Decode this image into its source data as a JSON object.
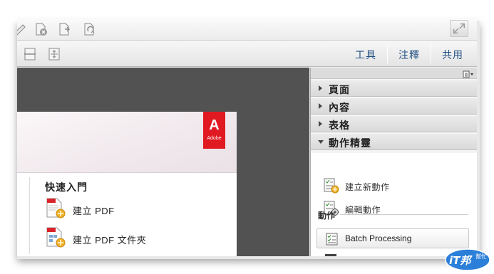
{
  "toolbar_tabs": {
    "tools": "工具",
    "comment": "注釋",
    "share": "共用"
  },
  "document": {
    "brand": {
      "glyph": "A",
      "word": "Adobe"
    },
    "quick_start": {
      "title": "快速入門",
      "items": [
        {
          "label": "建立 PDF",
          "icon": "create-pdf-icon"
        },
        {
          "label": "建立 PDF 文件夾",
          "icon": "create-portfolio-icon"
        }
      ]
    }
  },
  "panel": {
    "sections": [
      {
        "label": "頁面",
        "expanded": false
      },
      {
        "label": "內容",
        "expanded": false
      },
      {
        "label": "表格",
        "expanded": false
      },
      {
        "label": "動作精靈",
        "expanded": true
      }
    ],
    "wizard_items": [
      {
        "label": "建立新動作",
        "icon": "new-action-icon"
      },
      {
        "label": "編輯動作",
        "icon": "edit-action-icon"
      }
    ],
    "actions_label": "動作",
    "batch_label": "Batch Processing"
  },
  "watermark": {
    "brand": "iT邦",
    "sub": "幫忙"
  },
  "colors": {
    "accent_link": "#1f4f82",
    "adobe_red": "#e11a22",
    "doc_bg": "#525252"
  }
}
